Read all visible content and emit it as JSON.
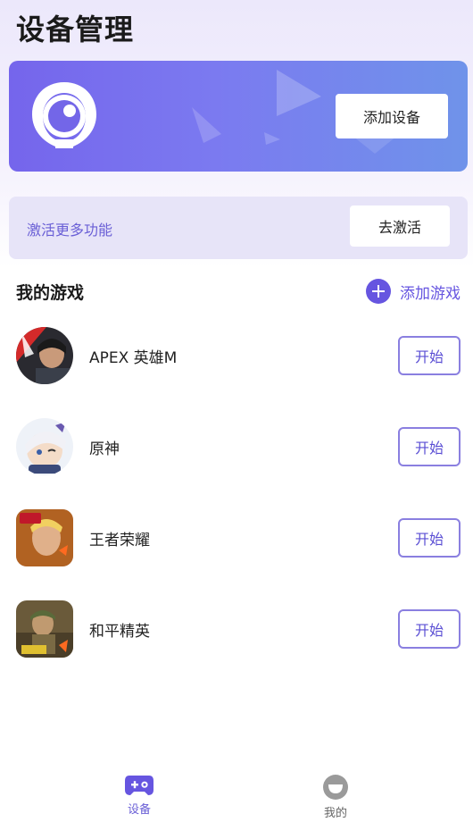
{
  "header": {
    "title": "设备管理"
  },
  "device_card": {
    "add_device_label": "添加设备"
  },
  "activate": {
    "text": "激活更多功能",
    "button_label": "去激活"
  },
  "games_section": {
    "title": "我的游戏",
    "add_label": "添加游戏",
    "games": [
      {
        "name": "APEX 英雄M",
        "start_label": "开始",
        "icon": "apex-icon"
      },
      {
        "name": "原神",
        "start_label": "开始",
        "icon": "genshin-icon"
      },
      {
        "name": "王者荣耀",
        "start_label": "开始",
        "icon": "honor-of-kings-icon"
      },
      {
        "name": "和平精英",
        "start_label": "开始",
        "icon": "peacekeeper-elite-icon"
      }
    ]
  },
  "bottom_nav": {
    "items": [
      {
        "label": "设备",
        "icon": "gamepad-icon",
        "active": true
      },
      {
        "label": "我的",
        "icon": "profile-icon",
        "active": false
      }
    ]
  },
  "colors": {
    "accent": "#6655e0",
    "banner_start": "#7565ec",
    "banner_end": "#6f93ea"
  }
}
